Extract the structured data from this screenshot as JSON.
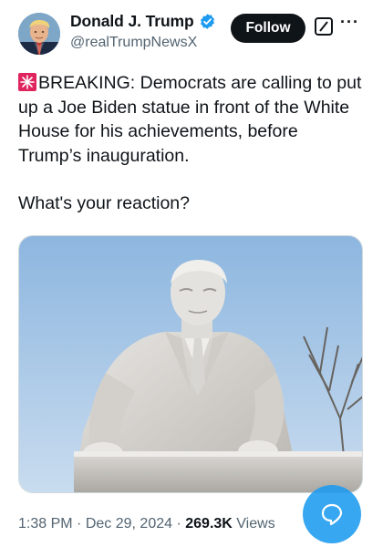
{
  "author": {
    "display_name": "Donald J. Trump",
    "handle": "@realTrumpNewsX",
    "verified_icon": "verified-badge-icon",
    "avatar_icon": "avatar"
  },
  "actions": {
    "follow_label": "Follow",
    "grok_icon": "grok-icon",
    "more_icon": "more-options-icon",
    "reply_icon": "reply-bubble-icon"
  },
  "tweet": {
    "emoji": "rotating-light-icon",
    "line1": "BREAKING: Democrats are calling to put up a Joe Biden statue in front of the White House for his achievements, before Trump’s inauguration.",
    "line2": "What's your reaction?"
  },
  "meta": {
    "time": "1:38 PM",
    "date": "Dec 29, 2024",
    "views_count": "269.3K",
    "views_label": "Views"
  },
  "colors": {
    "accent": "#1d9bf0",
    "text": "#0f1419",
    "secondary": "#536471"
  }
}
